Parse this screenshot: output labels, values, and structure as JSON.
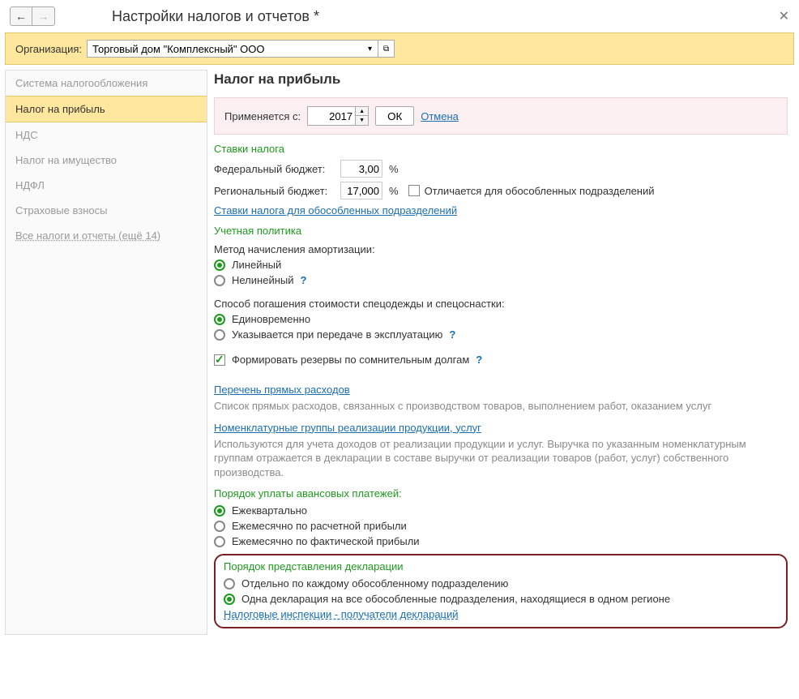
{
  "header": {
    "title": "Настройки налогов и отчетов *"
  },
  "org": {
    "label": "Организация:",
    "value": "Торговый дом \"Комплексный\" ООО"
  },
  "sidebar": {
    "items": [
      "Система налогообложения",
      "Налог на прибыль",
      "НДС",
      "Налог на имущество",
      "НДФЛ",
      "Страховые взносы",
      "Все налоги и отчеты (ещё 14)"
    ]
  },
  "content": {
    "heading": "Налог на прибыль",
    "apply": {
      "label": "Применяется с:",
      "year": "2017",
      "ok": "ОК",
      "cancel": "Отмена"
    },
    "rates": {
      "header": "Ставки налога",
      "federal_label": "Федеральный бюджет:",
      "federal_value": "3,00",
      "regional_label": "Региональный бюджет:",
      "regional_value": "17,000",
      "pct": "%",
      "diff_label": "Отличается для обособленных подразделений",
      "link": "Ставки налога для обособленных подразделений"
    },
    "policy": {
      "header": "Учетная политика",
      "amort_label": "Метод начисления амортизации:",
      "amort_linear": "Линейный",
      "amort_nonlinear": "Нелинейный",
      "spec_label": "Способ погашения стоимости спецодежды и спецоснастки:",
      "spec_once": "Единовременно",
      "spec_service": "Указывается при передаче в эксплуатацию",
      "reserves": "Формировать резервы по сомнительным долгам"
    },
    "direct": {
      "link": "Перечень прямых расходов",
      "desc": "Список прямых расходов, связанных с производством товаров, выполнением работ, оказанием услуг"
    },
    "nomen": {
      "link": "Номенклатурные группы реализации продукции, услуг",
      "desc": "Используются для учета доходов от реализации продукции и услуг. Выручка по указанным номенклатурным группам отражается в декларации в составе выручки от реализации товаров (работ, услуг) собственного производства."
    },
    "advance": {
      "header": "Порядок уплаты авансовых платежей:",
      "q": "Ежеквартально",
      "m_calc": "Ежемесячно по расчетной прибыли",
      "m_fact": "Ежемесячно по фактической прибыли"
    },
    "decl": {
      "header": "Порядок представления декларации",
      "sep": "Отдельно по каждому обособленному подразделению",
      "one": "Одна декларация на все обособленные подразделения, находящиеся в одном регионе",
      "link": "Налоговые инспекции - получатели деклараций"
    },
    "help": "?"
  }
}
